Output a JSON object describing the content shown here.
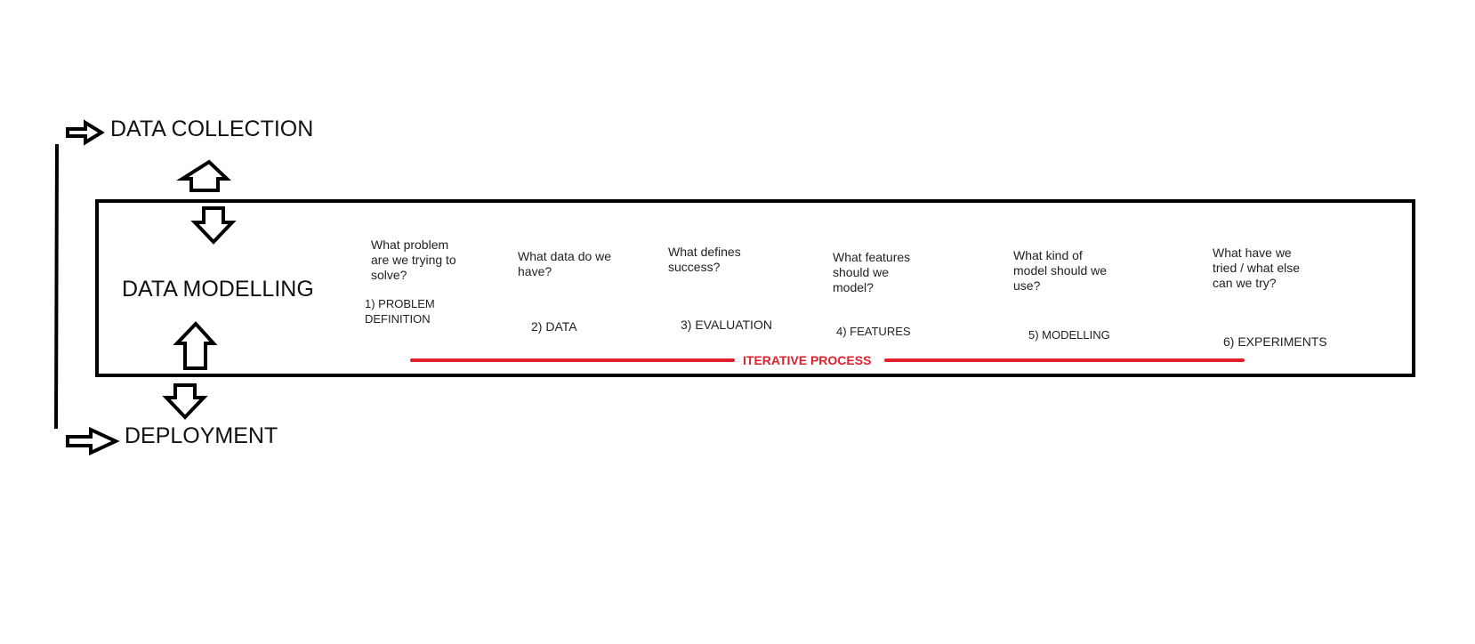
{
  "stages": {
    "collection": "DATA COLLECTION",
    "modelling": "DATA MODELLING",
    "deployment": "DEPLOYMENT"
  },
  "steps": [
    {
      "question": "What problem\nare we trying to\nsolve?",
      "label": "1) PROBLEM\nDEFINITION"
    },
    {
      "question": "What data do we\nhave?",
      "label": "2) DATA"
    },
    {
      "question": "What defines\nsuccess?",
      "label": "3) EVALUATION"
    },
    {
      "question": "What features\nshould we\nmodel?",
      "label": "4) FEATURES"
    },
    {
      "question": "What kind of\nmodel should we\nuse?",
      "label": "5) MODELLING"
    },
    {
      "question": "What have we\ntried / what else\ncan we try?",
      "label": "6) EXPERIMENTS"
    }
  ],
  "iterative": {
    "label": "ITERATIVE PROCESS",
    "color": "#e0202c"
  },
  "icons": {
    "right_arrow": "hollow-right-arrow-icon",
    "up_arrow": "hollow-up-arrow-icon",
    "down_arrow": "hollow-down-arrow-icon"
  }
}
